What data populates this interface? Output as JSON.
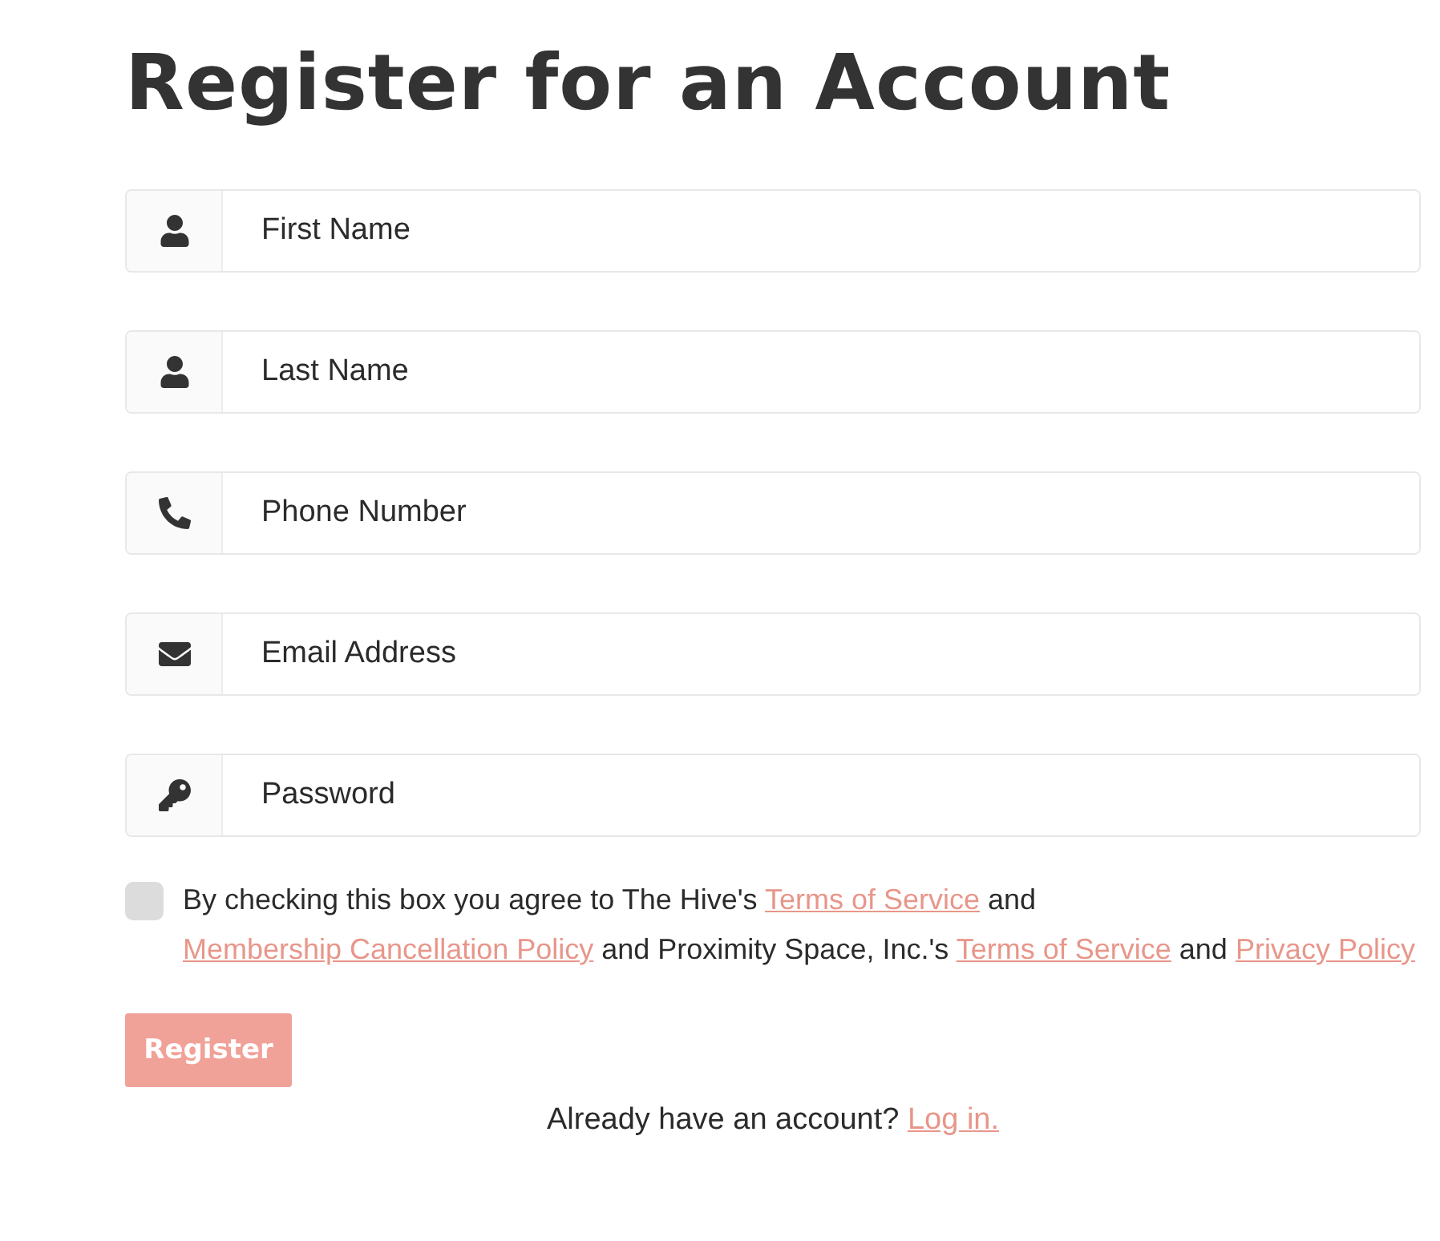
{
  "title": "Register for an Account",
  "fields": [
    {
      "kind": "person",
      "placeholder": "First Name"
    },
    {
      "kind": "person",
      "placeholder": "Last Name"
    },
    {
      "kind": "phone",
      "placeholder": "Phone Number"
    },
    {
      "kind": "email",
      "placeholder": "Email Address"
    },
    {
      "kind": "key",
      "placeholder": "Password"
    }
  ],
  "agreement": {
    "checked": false,
    "parts": [
      {
        "kind": "text",
        "text": "By checking this box you agree to The Hive's "
      },
      {
        "kind": "link",
        "text": "Terms of Service"
      },
      {
        "kind": "text",
        "text": " and "
      },
      {
        "kind": "link",
        "text": "Membership Cancellation Policy"
      },
      {
        "kind": "text",
        "text": " and Proximity Space, Inc.'s "
      },
      {
        "kind": "link",
        "text": "Terms of Service"
      },
      {
        "kind": "text",
        "text": " and "
      },
      {
        "kind": "link",
        "text": "Privacy Policy"
      }
    ]
  },
  "register_button": {
    "label": "Register",
    "disabled": true
  },
  "login_prompt": {
    "text": "Already have an account? ",
    "link": "Log in."
  }
}
